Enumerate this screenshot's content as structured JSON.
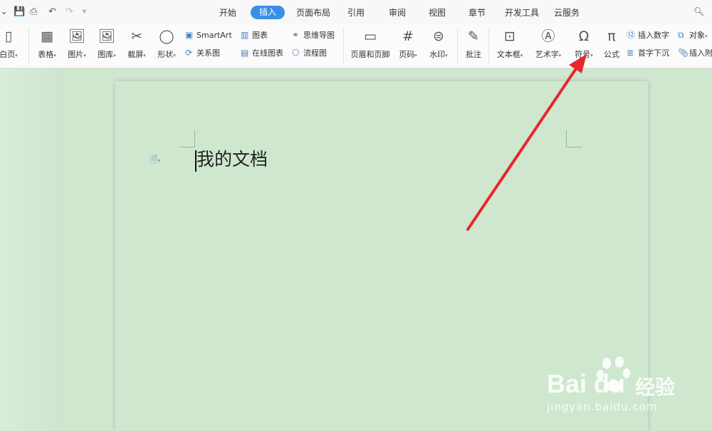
{
  "menubar": {
    "tabs": [
      "开始",
      "插入",
      "页面布局",
      "引用",
      "审阅",
      "视图",
      "章节",
      "开发工具",
      "云服务"
    ],
    "active_tab": "插入",
    "search_glyph": "搜"
  },
  "ribbon": {
    "blank_page": "白页",
    "table": "表格",
    "picture": "图片",
    "gallery": "图库",
    "screenshot": "截屏",
    "shape": "形状",
    "smartart": "SmartArt",
    "relation": "关系图",
    "chart": "图表",
    "online_chart": "在线图表",
    "mindmap": "思维导图",
    "flowchart": "流程图",
    "header_footer": "页眉和页脚",
    "page_number": "页码",
    "watermark": "水印",
    "comment": "批注",
    "textbox": "文本框",
    "wordart": "艺术字",
    "symbol": "符号",
    "formula": "公式",
    "insert_number": "插入数字",
    "drop_cap": "首字下沉",
    "object": "对象",
    "attachment": "插入附"
  },
  "document": {
    "text": "我的文档"
  },
  "watermark_text": {
    "logo": "Bai du",
    "cn": "经验",
    "url": "jingyan.baidu.com"
  },
  "colors": {
    "accent": "#3a8ee6",
    "page": "#cfe7cf",
    "arrow": "#e8262b"
  }
}
